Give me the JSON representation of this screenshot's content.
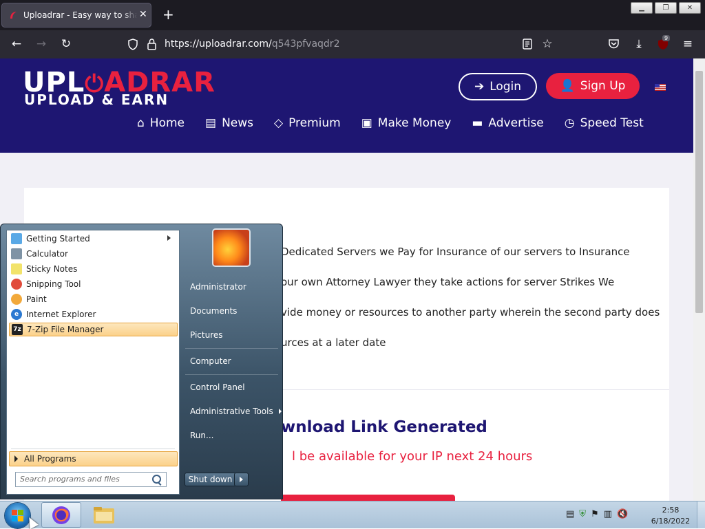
{
  "browser": {
    "tab_title": "Uploadrar - Easy way to share your files",
    "url_host": "https://uploadrar.com/",
    "url_path": "q543pfvaqdr2",
    "extension_badge": "9",
    "window_buttons": [
      "minimize",
      "restore",
      "close"
    ]
  },
  "site": {
    "logo_main_a": "UPL",
    "logo_main_b": "ADRAR",
    "logo_sub": "UPLOAD & EARN",
    "login_label": "Login",
    "signup_label": "Sign Up",
    "nav": [
      {
        "label": "Home",
        "icon": "home-icon"
      },
      {
        "label": "News",
        "icon": "newspaper-icon"
      },
      {
        "label": "Premium",
        "icon": "diamond-icon"
      },
      {
        "label": "Make Money",
        "icon": "money-icon"
      },
      {
        "label": "Advertise",
        "icon": "card-icon"
      },
      {
        "label": "Speed Test",
        "icon": "clock-icon"
      }
    ],
    "paragraph_lines": [
      "Dedicated Servers we Pay for Insurance of our servers to Insurance",
      "our own Attorney Lawyer they take actions for server Strikes We",
      "vide money or resources to another party wherein the second party does",
      "urces at a later date"
    ],
    "download_title": "wnload Link Generated",
    "download_subtitle": "l be available for your IP next 24 hours"
  },
  "start_menu": {
    "programs": [
      {
        "label": "Getting Started",
        "icon": "getting-started-icon",
        "color": "#5aa9e6",
        "has_submenu": true
      },
      {
        "label": "Calculator",
        "icon": "calculator-icon",
        "color": "#7f93a5",
        "has_submenu": false
      },
      {
        "label": "Sticky Notes",
        "icon": "sticky-notes-icon",
        "color": "#f2e36b",
        "has_submenu": false
      },
      {
        "label": "Snipping Tool",
        "icon": "snipping-tool-icon",
        "color": "#e14b3b",
        "has_submenu": false
      },
      {
        "label": "Paint",
        "icon": "paint-icon",
        "color": "#f2a93b",
        "has_submenu": false
      },
      {
        "label": "Internet Explorer",
        "icon": "internet-explorer-icon",
        "color": "#2b79d1",
        "has_submenu": false
      },
      {
        "label": "7-Zip File Manager",
        "icon": "7zip-icon",
        "color": "#222222",
        "has_submenu": false,
        "highlighted": true
      }
    ],
    "all_programs": "All Programs",
    "search_placeholder": "Search programs and files",
    "right_items": [
      "Administrator",
      "Documents",
      "Pictures",
      "Computer",
      "Control Panel",
      "Administrative Tools",
      "Run..."
    ],
    "shutdown": "Shut down"
  },
  "taskbar": {
    "time": "2:58",
    "date": "6/18/2022"
  },
  "colors": {
    "site_header": "#1e1672",
    "accent_red": "#e8213f",
    "browser_dark": "#1c1b22"
  }
}
